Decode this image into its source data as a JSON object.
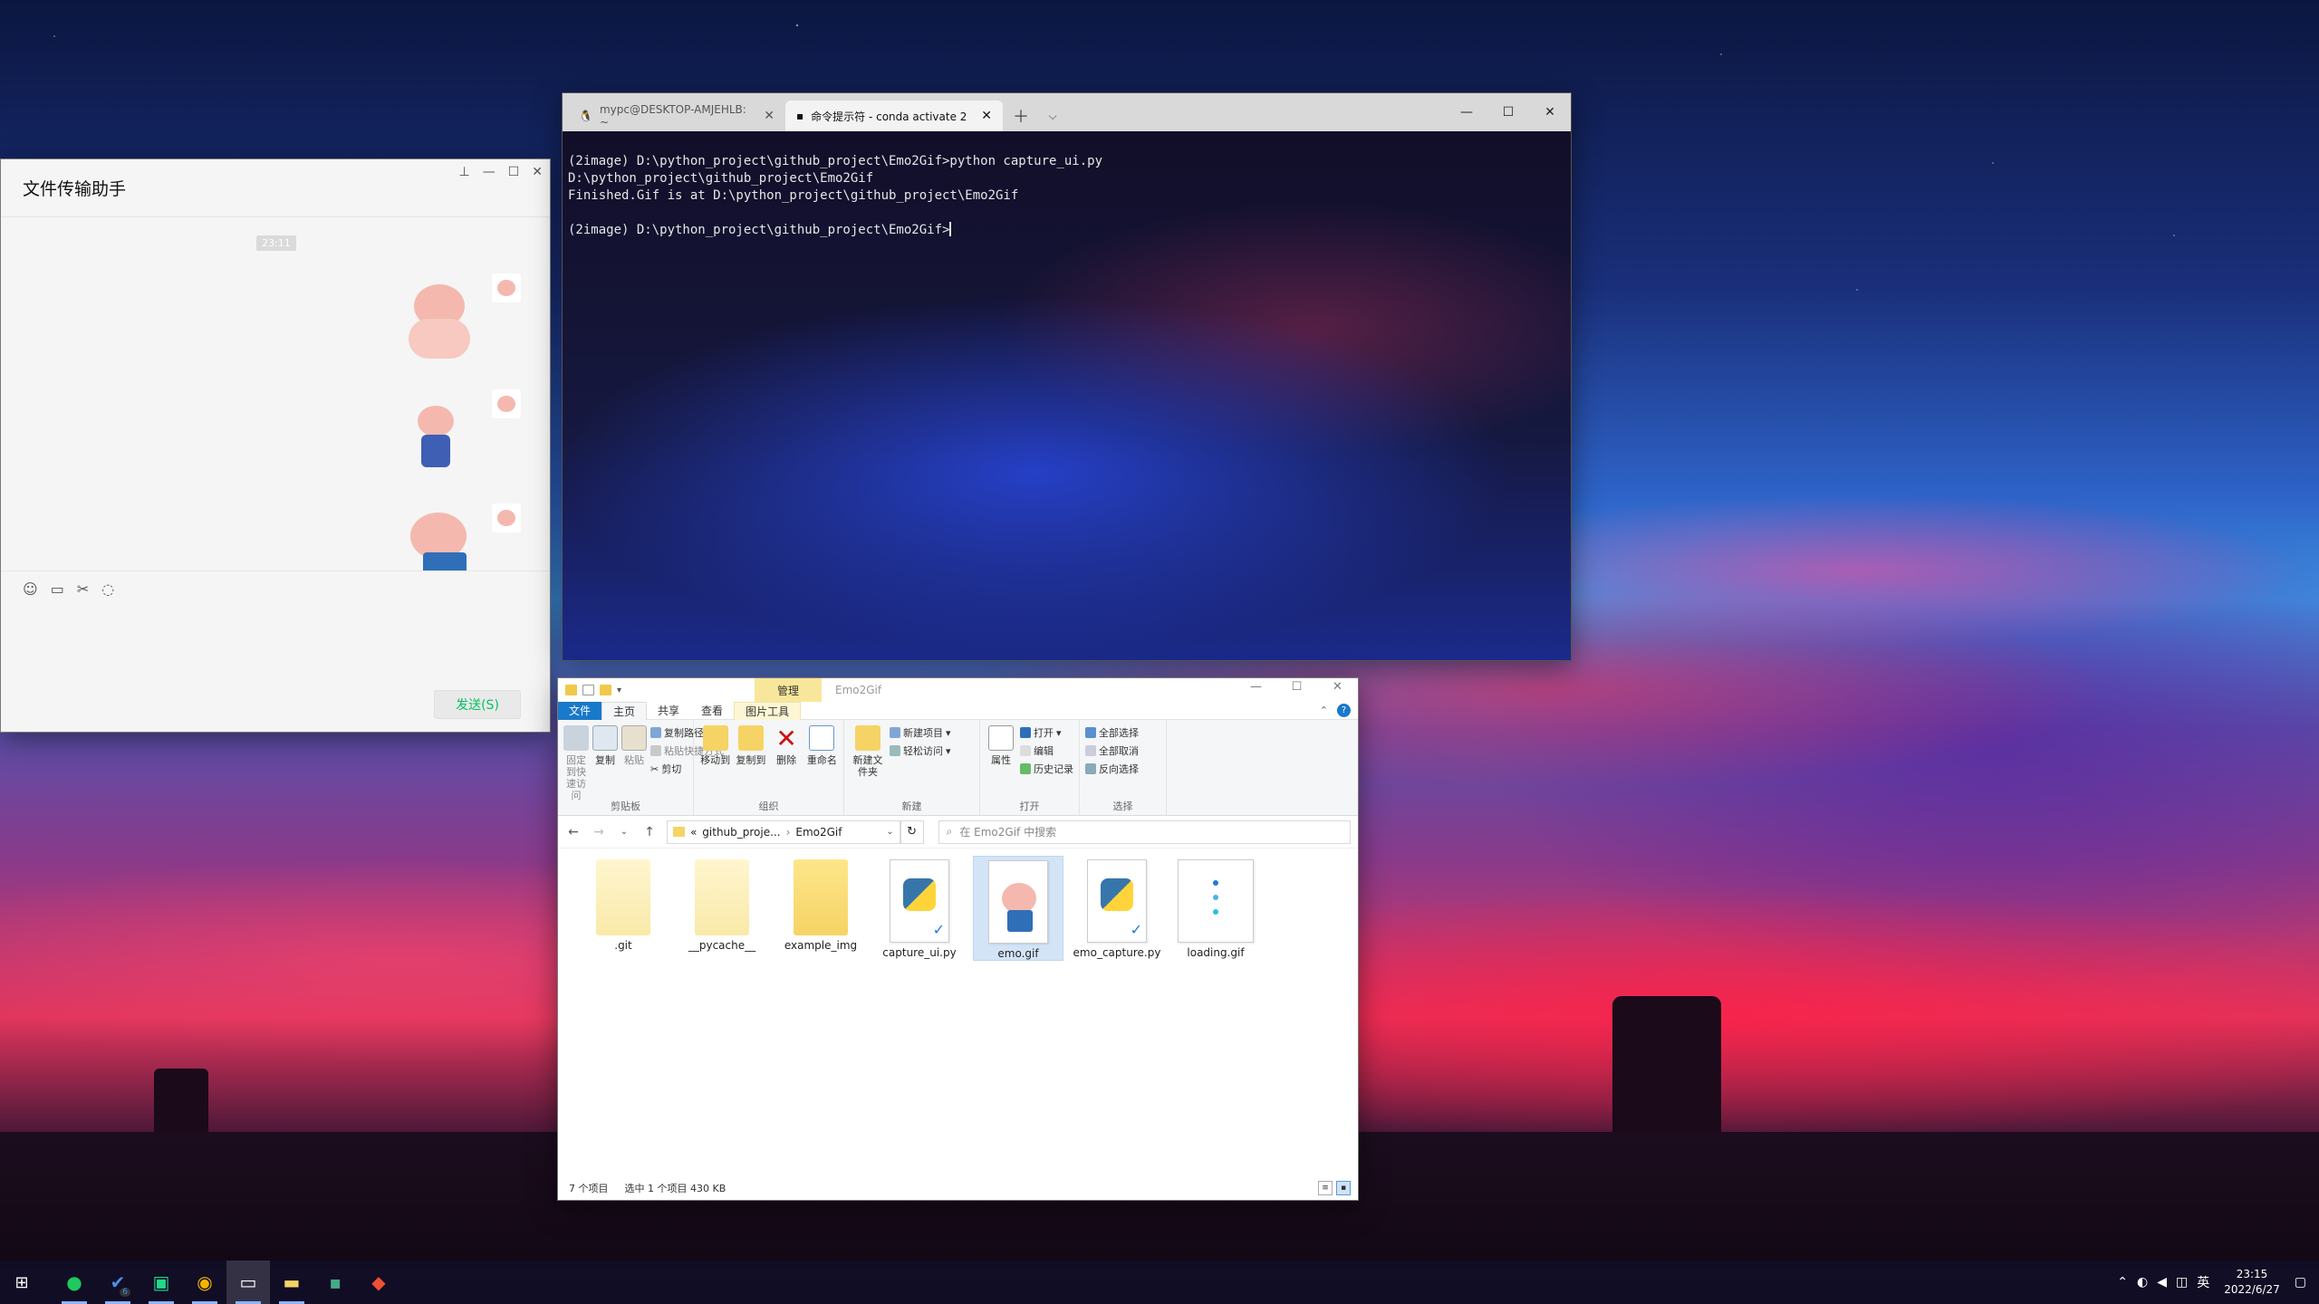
{
  "wechat": {
    "title": "文件传输助手",
    "timestamp": "23:11",
    "send_label": "发送(S)"
  },
  "terminal": {
    "tabs": [
      {
        "label": "mypc@DESKTOP-AMJEHLB: ~"
      },
      {
        "label": "命令提示符 - conda  activate 2"
      }
    ],
    "lines": [
      "(2image) D:\\python_project\\github_project\\Emo2Gif>python capture_ui.py",
      "D:\\python_project\\github_project\\Emo2Gif",
      "Finished.Gif is at D:\\python_project\\github_project\\Emo2Gif",
      "",
      "(2image) D:\\python_project\\github_project\\Emo2Gif>"
    ]
  },
  "explorer": {
    "context_tab": "管理",
    "title": "Emo2Gif",
    "ribbon_tabs": [
      "文件",
      "主页",
      "共享",
      "查看",
      "图片工具"
    ],
    "groups": {
      "clipboard": {
        "label": "剪贴板",
        "pin": "固定到快速访问",
        "copy": "复制",
        "paste": "粘贴",
        "copy_path": "复制路径",
        "paste_shortcut": "粘贴快捷方式",
        "cut": "剪切"
      },
      "organize": {
        "label": "组织",
        "move_to": "移动到",
        "copy_to": "复制到",
        "delete": "删除",
        "rename": "重命名"
      },
      "new": {
        "label": "新建",
        "new_folder": "新建文件夹",
        "new_item": "新建项目",
        "easy_access": "轻松访问"
      },
      "open": {
        "label": "打开",
        "properties": "属性",
        "open": "打开",
        "edit": "编辑",
        "history": "历史记录"
      },
      "select": {
        "label": "选择",
        "select_all": "全部选择",
        "select_none": "全部取消",
        "invert": "反向选择"
      }
    },
    "path": [
      "github_proje...",
      "Emo2Gif"
    ],
    "path_prefix": "«",
    "search_placeholder": "在 Emo2Gif 中搜索",
    "files": [
      {
        "name": ".git",
        "kind": "folder-light"
      },
      {
        "name": "__pycache__",
        "kind": "folder-light"
      },
      {
        "name": "example_img",
        "kind": "folder"
      },
      {
        "name": "capture_ui.py",
        "kind": "python"
      },
      {
        "name": "emo.gif",
        "kind": "gif",
        "selected": true
      },
      {
        "name": "emo_capture.py",
        "kind": "python"
      },
      {
        "name": "loading.gif",
        "kind": "loading"
      }
    ],
    "status": {
      "count": "7 个项目",
      "selected": "选中 1 个项目  430 KB"
    }
  },
  "taskbar": {
    "time": "23:15",
    "date": "2022/6/27",
    "ime": "英",
    "badge": "6"
  },
  "colors": {
    "wechat_green": "#07c160",
    "explorer_blue": "#1979ca",
    "manage_yellow": "#f8e79a"
  }
}
